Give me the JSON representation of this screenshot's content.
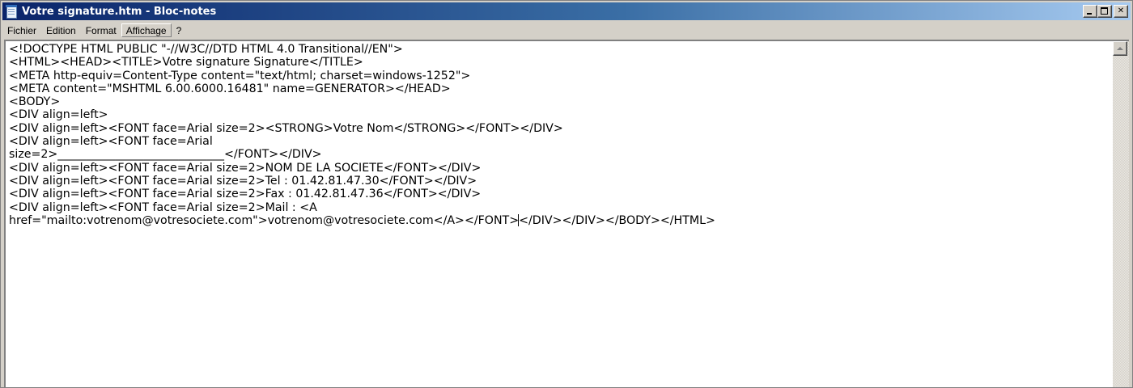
{
  "window": {
    "title": "Votre signature.htm - Bloc-notes"
  },
  "menu": {
    "items": [
      "Fichier",
      "Edition",
      "Format",
      "Affichage",
      "?"
    ],
    "active": "Affichage"
  },
  "editor": {
    "lines": [
      "<!DOCTYPE HTML PUBLIC \"-//W3C//DTD HTML 4.0 Transitional//EN\">",
      "<HTML><HEAD><TITLE>Votre signature Signature</TITLE>",
      "<META http-equiv=Content-Type content=\"text/html; charset=windows-1252\">",
      "<META content=\"MSHTML 6.00.6000.16481\" name=GENERATOR></HEAD>",
      "<BODY>",
      "<DIV align=left>",
      "<DIV align=left><FONT face=Arial size=2><STRONG>Votre Nom</STRONG></FONT></DIV>",
      "<DIV align=left><FONT face=Arial",
      "size=2>_____________________________</FONT></DIV>",
      "<DIV align=left><FONT face=Arial size=2>NOM DE LA SOCIETE</FONT></DIV>",
      "<DIV align=left><FONT face=Arial size=2>Tel : 01.42.81.47.30</FONT></DIV>",
      "<DIV align=left><FONT face=Arial size=2>Fax : 01.42.81.47.36</FONT></DIV>",
      "<DIV align=left><FONT face=Arial size=2>Mail : <A",
      "href=\"mailto:votrenom@votresociete.com\">votrenom@votresociete.com</A></FONT></DIV></DIV></BODY></HTML>"
    ],
    "last_line_before_caret": "href=\"mailto:votrenom@votresociete.com\">votrenom@votresociete.com</A></FONT>",
    "last_line_after_caret": "</DIV></DIV></BODY></HTML>"
  },
  "icons": {
    "app": "notepad-icon",
    "minimize": "minimize-icon",
    "maximize": "maximize-icon",
    "close": "close-icon",
    "scroll_up": "scroll-up-arrow-icon"
  }
}
